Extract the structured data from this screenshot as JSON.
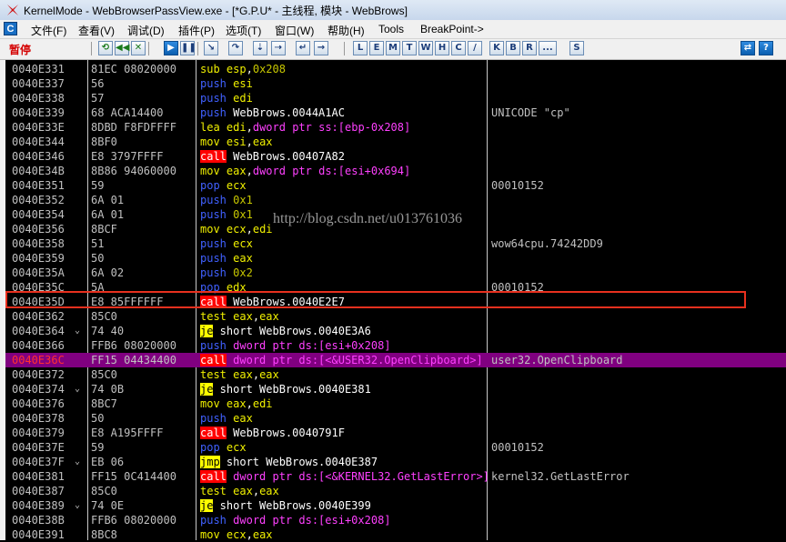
{
  "window": {
    "title": "KernelMode - WebBrowserPassView.exe - [*G.P.U* - 主线程, 模块 - WebBrows]"
  },
  "menu": {
    "items": [
      "文件(F)",
      "查看(V)",
      "调试(D)",
      "插件(P)",
      "选项(T)",
      "窗口(W)",
      "帮助(H)",
      "Tools",
      "BreakPoint->"
    ]
  },
  "toolbar": {
    "status": "暂停",
    "buttons_left": [
      "restart",
      "rewind",
      "close",
      "run",
      "pause",
      "step-into",
      "step-over",
      "trace-into",
      "trace-over",
      "execute-till-return",
      "goto"
    ],
    "letter_buttons": [
      "L",
      "E",
      "M",
      "T",
      "W",
      "H",
      "C",
      "/",
      "K",
      "B",
      "R",
      "...",
      "S"
    ],
    "buttons_right": [
      "refresh",
      "help"
    ]
  },
  "watermark": "http://blog.csdn.net/u013761036",
  "disasm": {
    "rows": [
      {
        "addr": "0040E331",
        "jmp": "",
        "hex": "81EC 08020000",
        "asm": [
          [
            "mn",
            "sub"
          ],
          [
            "op-text",
            " "
          ],
          [
            "op-reg",
            "esp"
          ],
          [
            "op-text",
            ","
          ],
          [
            "op-num",
            "0x208"
          ]
        ],
        "comment": ""
      },
      {
        "addr": "0040E337",
        "jmp": "",
        "hex": "56",
        "asm": [
          [
            "mn-push",
            "push"
          ],
          [
            "op-text",
            " "
          ],
          [
            "op-reg",
            "esi"
          ]
        ],
        "comment": ""
      },
      {
        "addr": "0040E338",
        "jmp": "",
        "hex": "57",
        "asm": [
          [
            "mn-push",
            "push"
          ],
          [
            "op-text",
            " "
          ],
          [
            "op-reg",
            "edi"
          ]
        ],
        "comment": ""
      },
      {
        "addr": "0040E339",
        "jmp": "",
        "hex": "68 ACA14400",
        "asm": [
          [
            "mn-push",
            "push"
          ],
          [
            "op-text",
            " WebBrows.0044A1AC"
          ]
        ],
        "comment": "UNICODE \"cp\""
      },
      {
        "addr": "0040E33E",
        "jmp": "",
        "hex": "8DBD F8FDFFFF",
        "asm": [
          [
            "mn",
            "lea"
          ],
          [
            "op-text",
            " "
          ],
          [
            "op-reg",
            "edi"
          ],
          [
            "op-text",
            ","
          ],
          [
            "op-mem",
            "dword ptr ss:[ebp-0x208]"
          ]
        ],
        "comment": ""
      },
      {
        "addr": "0040E344",
        "jmp": "",
        "hex": "8BF0",
        "asm": [
          [
            "mn",
            "mov"
          ],
          [
            "op-text",
            " "
          ],
          [
            "op-reg",
            "esi"
          ],
          [
            "op-text",
            ","
          ],
          [
            "op-reg",
            "eax"
          ]
        ],
        "comment": ""
      },
      {
        "addr": "0040E346",
        "jmp": "",
        "hex": "E8 3797FFFF",
        "asm": [
          [
            "mn-call",
            "call"
          ],
          [
            "op-text",
            " WebBrows.00407A82"
          ]
        ],
        "comment": ""
      },
      {
        "addr": "0040E34B",
        "jmp": "",
        "hex": "8B86 94060000",
        "asm": [
          [
            "mn",
            "mov"
          ],
          [
            "op-text",
            " "
          ],
          [
            "op-reg",
            "eax"
          ],
          [
            "op-text",
            ","
          ],
          [
            "op-mem",
            "dword ptr ds:[esi+0x694]"
          ]
        ],
        "comment": ""
      },
      {
        "addr": "0040E351",
        "jmp": "",
        "hex": "59",
        "asm": [
          [
            "mn-push",
            "pop"
          ],
          [
            "op-text",
            " "
          ],
          [
            "op-reg",
            "ecx"
          ]
        ],
        "comment": "00010152"
      },
      {
        "addr": "0040E352",
        "jmp": "",
        "hex": "6A 01",
        "asm": [
          [
            "mn-push",
            "push"
          ],
          [
            "op-text",
            " "
          ],
          [
            "op-num",
            "0x1"
          ]
        ],
        "comment": ""
      },
      {
        "addr": "0040E354",
        "jmp": "",
        "hex": "6A 01",
        "asm": [
          [
            "mn-push",
            "push"
          ],
          [
            "op-text",
            " "
          ],
          [
            "op-num",
            "0x1"
          ]
        ],
        "comment": ""
      },
      {
        "addr": "0040E356",
        "jmp": "",
        "hex": "8BCF",
        "asm": [
          [
            "mn",
            "mov"
          ],
          [
            "op-text",
            " "
          ],
          [
            "op-reg",
            "ecx"
          ],
          [
            "op-text",
            ","
          ],
          [
            "op-reg",
            "edi"
          ]
        ],
        "comment": ""
      },
      {
        "addr": "0040E358",
        "jmp": "",
        "hex": "51",
        "asm": [
          [
            "mn-push",
            "push"
          ],
          [
            "op-text",
            " "
          ],
          [
            "op-reg",
            "ecx"
          ]
        ],
        "comment": "wow64cpu.74242DD9"
      },
      {
        "addr": "0040E359",
        "jmp": "",
        "hex": "50",
        "asm": [
          [
            "mn-push",
            "push"
          ],
          [
            "op-text",
            " "
          ],
          [
            "op-reg",
            "eax"
          ]
        ],
        "comment": ""
      },
      {
        "addr": "0040E35A",
        "jmp": "",
        "hex": "6A 02",
        "asm": [
          [
            "mn-push",
            "push"
          ],
          [
            "op-text",
            " "
          ],
          [
            "op-num",
            "0x2"
          ]
        ],
        "comment": ""
      },
      {
        "addr": "0040E35C",
        "jmp": "",
        "hex": "5A",
        "asm": [
          [
            "mn-push",
            "pop"
          ],
          [
            "op-text",
            " "
          ],
          [
            "op-reg",
            "edx"
          ]
        ],
        "comment": "00010152"
      },
      {
        "addr": "0040E35D",
        "jmp": "",
        "hex": "E8 85FFFFFF",
        "asm": [
          [
            "mn-call",
            "call"
          ],
          [
            "op-text",
            " WebBrows.0040E2E7"
          ]
        ],
        "comment": ""
      },
      {
        "addr": "0040E362",
        "jmp": "",
        "hex": "85C0",
        "asm": [
          [
            "mn",
            "test"
          ],
          [
            "op-text",
            " "
          ],
          [
            "op-reg",
            "eax"
          ],
          [
            "op-text",
            ","
          ],
          [
            "op-reg",
            "eax"
          ]
        ],
        "comment": ""
      },
      {
        "addr": "0040E364",
        "jmp": "⌄",
        "hex": "74 40",
        "asm": [
          [
            "mn-jcc",
            "je"
          ],
          [
            "op-text",
            " short WebBrows.0040E3A6"
          ]
        ],
        "comment": ""
      },
      {
        "addr": "0040E366",
        "jmp": "",
        "hex": "FFB6 08020000",
        "asm": [
          [
            "mn-push",
            "push"
          ],
          [
            "op-text",
            " "
          ],
          [
            "op-mem",
            "dword ptr ds:[esi+0x208]"
          ]
        ],
        "comment": ""
      },
      {
        "addr": "0040E36C",
        "jmp": "",
        "hex": "FF15 04434400",
        "asm": [
          [
            "mn-call",
            "call"
          ],
          [
            "op-text",
            " "
          ],
          [
            "op-mem",
            "dword ptr ds:[<&USER32.OpenClipboard>]"
          ]
        ],
        "comment": "user32.OpenClipboard",
        "selected": true
      },
      {
        "addr": "0040E372",
        "jmp": "",
        "hex": "85C0",
        "asm": [
          [
            "mn",
            "test"
          ],
          [
            "op-text",
            " "
          ],
          [
            "op-reg",
            "eax"
          ],
          [
            "op-text",
            ","
          ],
          [
            "op-reg",
            "eax"
          ]
        ],
        "comment": ""
      },
      {
        "addr": "0040E374",
        "jmp": "⌄",
        "hex": "74 0B",
        "asm": [
          [
            "mn-jcc",
            "je"
          ],
          [
            "op-text",
            " short WebBrows.0040E381"
          ]
        ],
        "comment": ""
      },
      {
        "addr": "0040E376",
        "jmp": "",
        "hex": "8BC7",
        "asm": [
          [
            "mn",
            "mov"
          ],
          [
            "op-text",
            " "
          ],
          [
            "op-reg",
            "eax"
          ],
          [
            "op-text",
            ","
          ],
          [
            "op-reg",
            "edi"
          ]
        ],
        "comment": ""
      },
      {
        "addr": "0040E378",
        "jmp": "",
        "hex": "50",
        "asm": [
          [
            "mn-push",
            "push"
          ],
          [
            "op-text",
            " "
          ],
          [
            "op-reg",
            "eax"
          ]
        ],
        "comment": ""
      },
      {
        "addr": "0040E379",
        "jmp": "",
        "hex": "E8 A195FFFF",
        "asm": [
          [
            "mn-call",
            "call"
          ],
          [
            "op-text",
            " WebBrows.0040791F"
          ]
        ],
        "comment": ""
      },
      {
        "addr": "0040E37E",
        "jmp": "",
        "hex": "59",
        "asm": [
          [
            "mn-push",
            "pop"
          ],
          [
            "op-text",
            " "
          ],
          [
            "op-reg",
            "ecx"
          ]
        ],
        "comment": "00010152"
      },
      {
        "addr": "0040E37F",
        "jmp": "⌄",
        "hex": "EB 06",
        "asm": [
          [
            "mn-jcc",
            "jmp"
          ],
          [
            "op-text",
            " short WebBrows.0040E387"
          ]
        ],
        "comment": ""
      },
      {
        "addr": "0040E381",
        "jmp": "",
        "hex": "FF15 0C414400",
        "asm": [
          [
            "mn-call",
            "call"
          ],
          [
            "op-text",
            " "
          ],
          [
            "op-mem",
            "dword ptr ds:[<&KERNEL32.GetLastError>]"
          ]
        ],
        "comment": "kernel32.GetLastError"
      },
      {
        "addr": "0040E387",
        "jmp": "",
        "hex": "85C0",
        "asm": [
          [
            "mn",
            "test"
          ],
          [
            "op-text",
            " "
          ],
          [
            "op-reg",
            "eax"
          ],
          [
            "op-text",
            ","
          ],
          [
            "op-reg",
            "eax"
          ]
        ],
        "comment": ""
      },
      {
        "addr": "0040E389",
        "jmp": "⌄",
        "hex": "74 0E",
        "asm": [
          [
            "mn-jcc",
            "je"
          ],
          [
            "op-text",
            " short WebBrows.0040E399"
          ]
        ],
        "comment": ""
      },
      {
        "addr": "0040E38B",
        "jmp": "",
        "hex": "FFB6 08020000",
        "asm": [
          [
            "mn-push",
            "push"
          ],
          [
            "op-text",
            " "
          ],
          [
            "op-mem",
            "dword ptr ds:[esi+0x208]"
          ]
        ],
        "comment": ""
      },
      {
        "addr": "0040E391",
        "jmp": "",
        "hex": "8BC8",
        "asm": [
          [
            "mn",
            "mov"
          ],
          [
            "op-text",
            " "
          ],
          [
            "op-reg",
            "ecx"
          ],
          [
            "op-text",
            ","
          ],
          [
            "op-reg",
            "eax"
          ]
        ],
        "comment": ""
      }
    ]
  }
}
